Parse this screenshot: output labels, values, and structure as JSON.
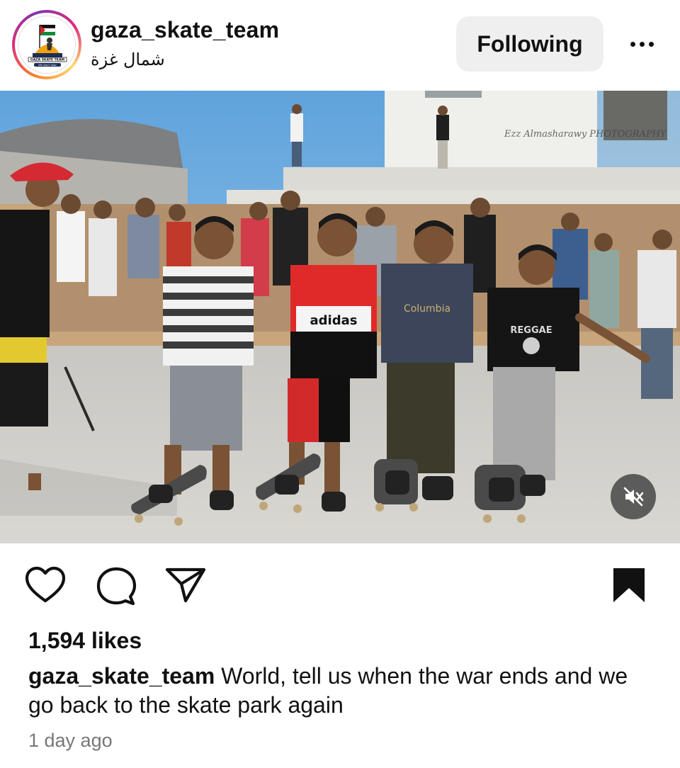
{
  "post": {
    "username": "gaza_skate_team",
    "location": "شمال غزة",
    "follow_label": "Following",
    "avatar": {
      "text_top": "GAZA SKATE TEAM",
      "text_bottom": "We won't stop"
    },
    "photo": {
      "watermark": "Ezz Almasharawy PHOTOGRAPHY",
      "shirt_text_1": "adidas",
      "shirt_text_2": "Columbia",
      "shirt_text_3": "REGGAE"
    },
    "likes": "1,594 likes",
    "caption_user": "gaza_skate_team",
    "caption_text": " World, tell us when the war ends and we go back to the skate park again",
    "timestamp": "1 day ago"
  },
  "icons": {
    "more": "more-options-icon",
    "mute": "muted-speaker-icon",
    "like": "heart-icon",
    "comment": "comment-bubble-icon",
    "share": "paper-plane-icon",
    "save": "bookmark-icon"
  },
  "colors": {
    "follow_button_bg": "#efefef",
    "text": "#111111",
    "muted_text": "#777777"
  }
}
